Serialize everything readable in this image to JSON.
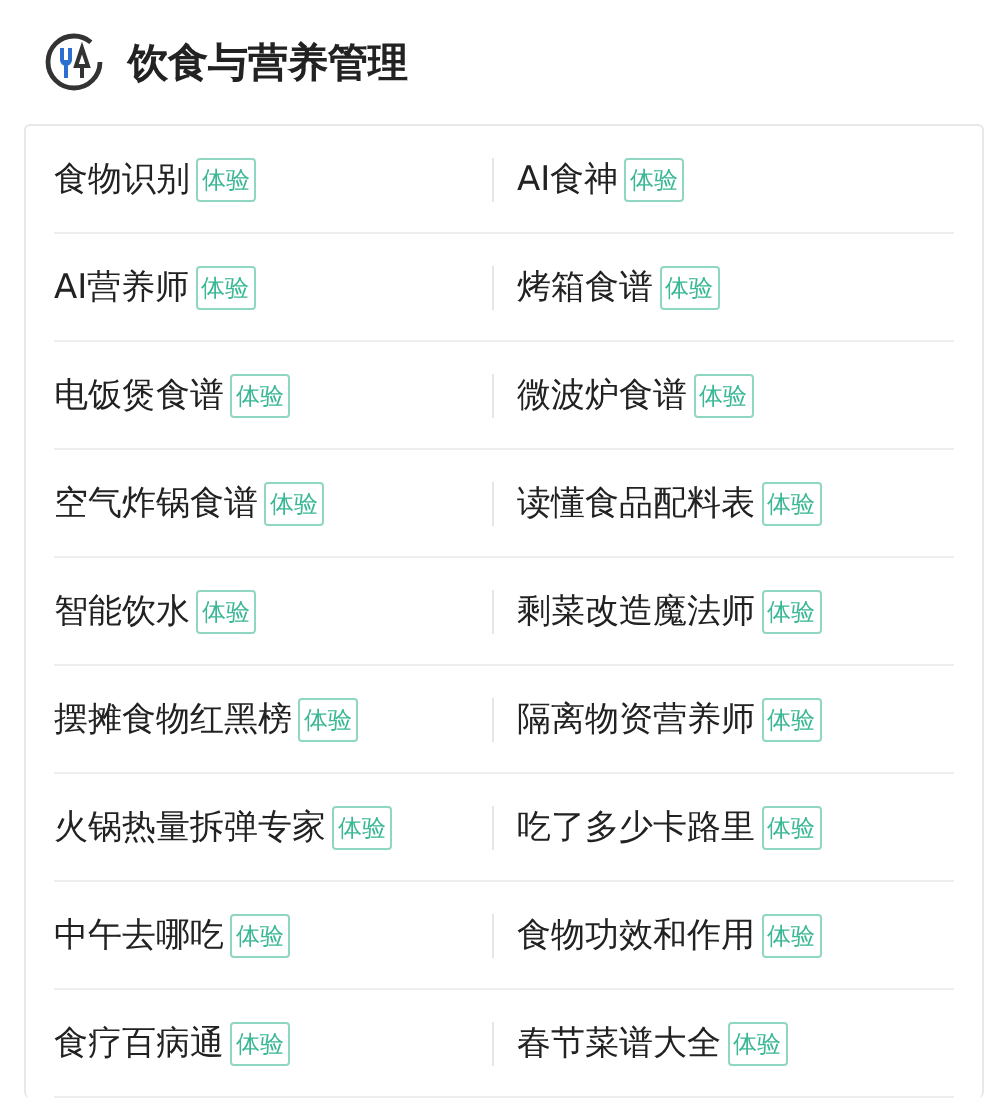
{
  "header": {
    "title": "饮食与营养管理"
  },
  "tools": [
    {
      "name": "食物识别",
      "badge": "体验"
    },
    {
      "name": "AI食神",
      "badge": "体验"
    },
    {
      "name": "AI营养师",
      "badge": "体验"
    },
    {
      "name": "烤箱食谱",
      "badge": "体验"
    },
    {
      "name": "电饭煲食谱",
      "badge": "体验"
    },
    {
      "name": "微波炉食谱",
      "badge": "体验"
    },
    {
      "name": "空气炸锅食谱",
      "badge": "体验"
    },
    {
      "name": "读懂食品配料表",
      "badge": "体验"
    },
    {
      "name": "智能饮水",
      "badge": "体验"
    },
    {
      "name": "剩菜改造魔法师",
      "badge": "体验"
    },
    {
      "name": "摆摊食物红黑榜",
      "badge": "体验"
    },
    {
      "name": "隔离物资营养师",
      "badge": "体验"
    },
    {
      "name": "火锅热量拆弹专家",
      "badge": "体验"
    },
    {
      "name": "吃了多少卡路里",
      "badge": "体验"
    },
    {
      "name": "中午去哪吃",
      "badge": "体验"
    },
    {
      "name": "食物功效和作用",
      "badge": "体验"
    },
    {
      "name": "食疗百病通",
      "badge": "体验"
    },
    {
      "name": "春节菜谱大全",
      "badge": "体验"
    }
  ]
}
